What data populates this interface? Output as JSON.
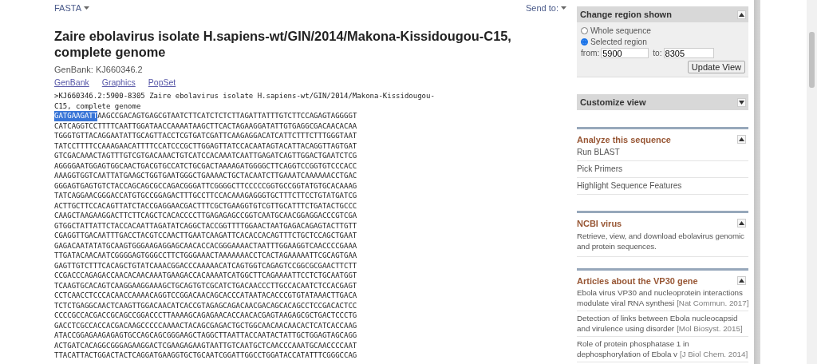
{
  "toolbar": {
    "format_menu": "FASTA",
    "send_to": "Send to:"
  },
  "title": "Zaire ebolavirus isolate H.sapiens-wt/GIN/2014/Makona-Kissidougou-C15, complete genome",
  "accession": "GenBank: KJ660346.2",
  "links": [
    "GenBank",
    "Graphics",
    "PopSet"
  ],
  "fasta": {
    "header_lines": [
      ">KJ660346.2:5900-8305 Zaire ebolavirus isolate H.sapiens-wt/GIN/2014/Makona-Kissidougou-",
      "C15, complete genome"
    ],
    "selected": "GATGAAGATT",
    "lines": [
      "AAGCCGACAGTGAGCGTAATCTTCATCTCTCTTAGATTATTTGTCTTCCAGAGTAGGGGT",
      "CATCAGGTCCTTTTCAATTGGATAACCAAAATAAGCTTCACTAGAAGGATATTGTGAGGCGACAACACAA",
      "TGGGTGTTACAGGAATATTGCAGTTACCTCGTGATCGATTCAAGAGGACATCATTCTTTCTTTGGGTAAT",
      "TATCCTTTTCCAAAGAACATTTTCCATCCCGCTTGGAGTTATCCACAATAGTACATTACAGGTTAGTGAT",
      "GTCGACAAACTAGTTTGTCGTGACAAACTGTCATCCACAAATCAATTGAGATCAGTTGGACTGAATCTCG",
      "AGGGGAATGGAGTGGCAACTGACGTGCCATCTGCGACTAAAAGATGGGGCTTCAGGTCCGGTGTCCCACC",
      "AAAGGTGGTCAATTATGAAGCTGGTGAATGGGCTGAAAACTGCTACAATCTTGAAATCAAAAAACCTGAC",
      "GGGAGTGAGTGTCTACCAGCAGCGCCAGACGGGATTCGGGGCTTCCCCCGGTGCCGGTATGTGCACAAAG",
      "TATCAGGAACGGGACCATGTGCCGGAGACTTTGCCTTCCACAAAGAGGGTGCTTTCTTCCTGTATGATCG",
      "ACTTGCTTCCACAGTTATCTACCGAGGAACGACTTTCGCTGAAGGTGTCGTTGCATTTCTGATACTGCCC",
      "CAAGCTAAGAAGGACTTCTTCAGCTCACACCCCTTGAGAGAGCCGGTCAATGCAACGGAGGACCCGTCGA",
      "GTGGCTATTATTCTACCACAATTAGATATCAGGCTACCGGTTTTGGAACTAATGAGACAGAGTACTTGTT",
      "CGAGGTTGACAATTTGACCTACGTCCAACTTGAATCAAGATTCACACCACAGTTTCTGCTCCAGCTGAAT",
      "GAGACAATATATGCAAGTGGGAAGAGGAGCAACACCACGGGAAAACTAATTTGGAAGGTCAACCCCGAAA",
      "TTGATACAACAATCGGGGAGTGGGCCTTCTGGGAAACTAAAAAAACCTCACTAGAAAAATTCGCAGTGAA",
      "GAGTTGTCTTTCACAGCTGTATCAAACGGACCCAAAAACATCAGTGGTCAGAGTCCGGCGCGAACTTCTT",
      "CCGACCCAGAGACCAACACAACAAATGAAGACCACAAAATCATGGCTTCAGAAAATTCCTCTGCAATGGT",
      "TCAAGTGCACAGTCAAGGAAGGAAAGCTGCAGTGTCGCATCTGACAACCCTTGCCACAATCTCCACGAGT",
      "CCTCAACCTCCCACAACCAAAACAGGTCCGGACAACAGCACCCATAATACACCCGTGTATAAACTTGACA",
      "TCTCTGAGGCAACTCAAGTTGGACAACATCACCGTAGAGCAGACAACGACAGCACAGCCTCCGACACTCC",
      "CCCCGCCACGACCGCAGCCGGACCCTTAAAAGCAGAGAACACCAACACGAGTAAGAGCGCTGACTCCCTG",
      "GACCTCGCCACCACGACAAGCCCCCAAAACTACAGCGAGACTGCTGGCAACAACAACACTCATCACCAAG",
      "ATACCGGAGAAGAGAGTGCCAGCAGCGGGAAGCTAGGCTTAATTACCAATACTATTGCTGGAGTAGCAGG",
      "ACTGATCACAGGCGGGAGAAGGACTCGAAGAGAAGTAATTGTCAATGCTCAACCCAAATGCAACCCCAAT",
      "TTACATTACTGGACTACTCAGGATGAAGGTGCTGCAATCGGATTGGCCTGGATACCATATTTCGGGCCAG"
    ]
  },
  "change_region": {
    "title": "Change region shown",
    "expanded": true,
    "options": [
      {
        "label": "Whole sequence",
        "selected": false
      },
      {
        "label": "Selected region",
        "selected": true
      }
    ],
    "from_label": "from:",
    "from_value": "5900",
    "to_label": "to:",
    "to_value": "8305",
    "button": "Update View"
  },
  "customize": {
    "title": "Customize view",
    "expanded": false
  },
  "analyze": {
    "title": "Analyze this sequence",
    "expanded": true,
    "links": [
      "Run BLAST",
      "Pick Primers",
      "Highlight Sequence Features"
    ]
  },
  "ncbi_virus": {
    "title": "NCBI virus",
    "expanded": true,
    "description": "Retrieve, view, and download ebolavirus genomic and protein sequences."
  },
  "articles": {
    "title": "Articles about the VP30 gene",
    "expanded": true,
    "items": [
      {
        "title_lines": [
          "Ebola virus VP30 and nucleoprotein interactions",
          "modulate viral RNA synthesi"
        ],
        "source": "[Nat Commun. 2017]"
      },
      {
        "title_lines": [
          "Detection of links between Ebola nucleocapsid",
          "and virulence using disorder"
        ],
        "source": "[Mol Biosyst. 2015]"
      },
      {
        "title_lines": [
          "Role of protein phosphatase 1 in",
          "dephosphorylation of Ebola v"
        ],
        "source": "[J Biol Chem. 2014]"
      }
    ]
  }
}
